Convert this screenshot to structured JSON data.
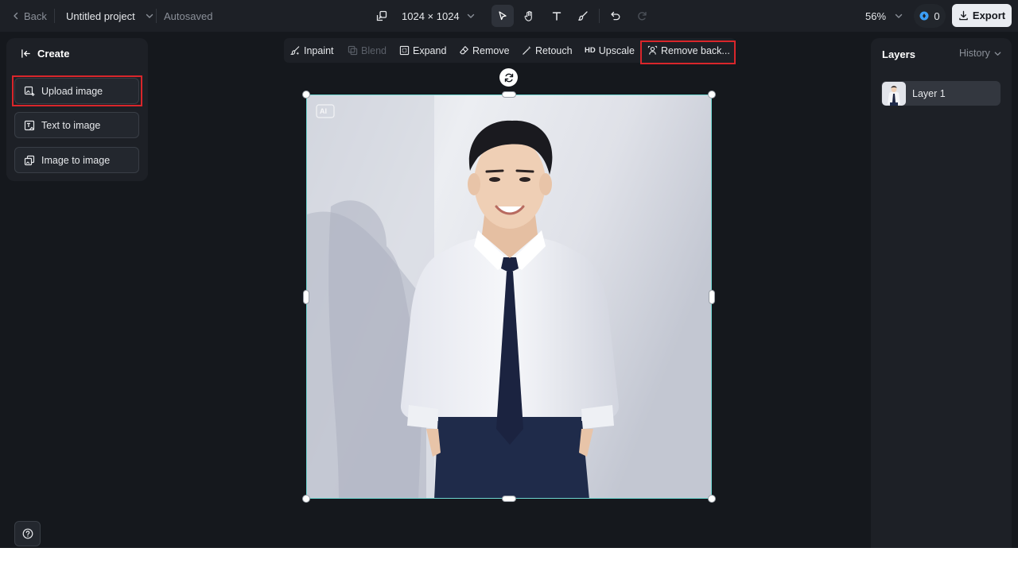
{
  "topbar": {
    "back_label": "Back",
    "project_title": "Untitled project",
    "autosave_status": "Autosaved",
    "canvas_size": "1024 × 1024",
    "zoom": "56%",
    "credits": "0",
    "export_label": "Export"
  },
  "left_panel": {
    "create_label": "Create",
    "items": [
      {
        "label": "Upload image"
      },
      {
        "label": "Text to image"
      },
      {
        "label": "Image to image"
      }
    ]
  },
  "edit_toolbar": {
    "inpaint": "Inpaint",
    "blend": "Blend",
    "expand": "Expand",
    "remove": "Remove",
    "retouch": "Retouch",
    "upscale_badge": "HD",
    "upscale": "Upscale",
    "remove_background": "Remove back..."
  },
  "canvas": {
    "ai_badge": "AI",
    "image_subject": "portrait photo of a smiling man in white shirt and navy tie"
  },
  "right_panel": {
    "title": "Layers",
    "history_label": "History",
    "layers": [
      {
        "label": "Layer 1"
      }
    ]
  },
  "colors": {
    "background": "#15181d",
    "panel": "#1d2026",
    "accent_selection": "#6fd6d1",
    "highlight_box": "#d9262b",
    "credit_icon": "#3b9df5"
  }
}
